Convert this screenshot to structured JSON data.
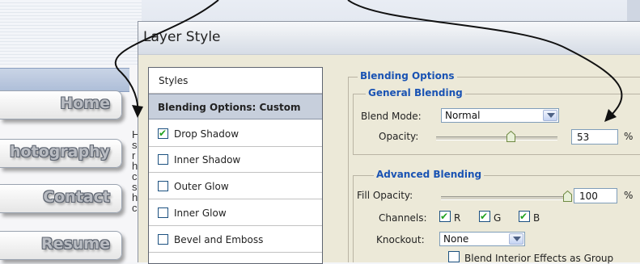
{
  "website": {
    "nav": [
      "Home",
      "hotography",
      "Contact",
      "Resume"
    ],
    "text_col": [
      "H",
      "s",
      "r",
      "h",
      "c",
      "s",
      "h",
      "c"
    ]
  },
  "dialog": {
    "title": "Layer Style",
    "styles_list": {
      "header": "Styles",
      "selected": "Blending Options: Custom",
      "items": [
        {
          "label": "Drop Shadow",
          "checked": true
        },
        {
          "label": "Inner Shadow",
          "checked": false
        },
        {
          "label": "Outer Glow",
          "checked": false
        },
        {
          "label": "Inner Glow",
          "checked": false
        },
        {
          "label": "Bevel and Emboss",
          "checked": false
        }
      ]
    },
    "blending_options": {
      "title": "Blending Options",
      "general": {
        "title": "General Blending",
        "blend_mode_label": "Blend Mode:",
        "blend_mode_value": "Normal",
        "opacity_label": "Opacity:",
        "opacity_value": "53",
        "opacity_unit": "%"
      },
      "advanced": {
        "title": "Advanced Blending",
        "fill_opacity_label": "Fill Opacity:",
        "fill_opacity_value": "100",
        "fill_opacity_unit": "%",
        "channels_label": "Channels:",
        "channels": [
          {
            "label": "R",
            "checked": true
          },
          {
            "label": "G",
            "checked": true
          },
          {
            "label": "B",
            "checked": true
          }
        ],
        "knockout_label": "Knockout:",
        "knockout_value": "None",
        "blend_interior_label": "Blend Interior Effects as Group",
        "blend_interior_checked": false
      }
    }
  },
  "colors": {
    "section_title": "#1a53b3",
    "dialog_bg": "#ece9d8",
    "check_green": "#21a121",
    "selected_row": "#c7cfdc"
  }
}
